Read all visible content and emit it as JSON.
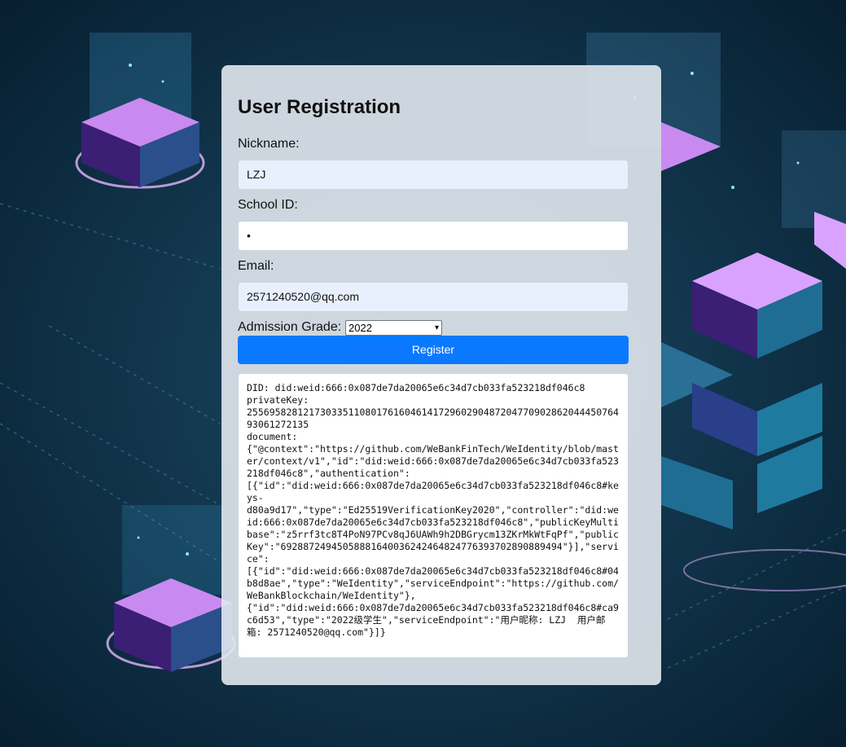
{
  "form": {
    "title": "User Registration",
    "nickname_label": "Nickname:",
    "nickname_value": "LZJ",
    "school_id_label": "School ID:",
    "school_id_value": "•",
    "email_label": "Email:",
    "email_value": "2571240520@qq.com",
    "grade_label": "Admission Grade:",
    "grade_value": "2022",
    "register_label": "Register",
    "output": "DID: did:weid:666:0x087de7da20065e6c34d7cb033fa523218df046c8\nprivateKey:\n25569582812173033511080176160461417296029048720477090286204445076493061272135\ndocument:\n{\"@context\":\"https://github.com/WeBankFinTech/WeIdentity/blob/master/context/v1\",\"id\":\"did:weid:666:0x087de7da20065e6c34d7cb033fa523218df046c8\",\"authentication\":\n[{\"id\":\"did:weid:666:0x087de7da20065e6c34d7cb033fa523218df046c8#keys-\nd80a9d17\",\"type\":\"Ed25519VerificationKey2020\",\"controller\":\"did:weid:666:0x087de7da20065e6c34d7cb033fa523218df046c8\",\"publicKeyMultibase\":\"z5rrf3tc8T4PoN97PCv8qJ6UAWh9h2DBGrycm13ZKrMkWtFqPf\",\"publicKey\":\"69288724945058881640036242464824776393702890889494\"}],\"service\":\n[{\"id\":\"did:weid:666:0x087de7da20065e6c34d7cb033fa523218df046c8#04b8d8ae\",\"type\":\"WeIdentity\",\"serviceEndpoint\":\"https://github.com/WeBankBlockchain/WeIdentity\"},\n{\"id\":\"did:weid:666:0x087de7da20065e6c34d7cb033fa523218df046c8#ca9c6d53\",\"type\":\"2022级学生\",\"serviceEndpoint\":\"用户昵称: LZJ  用户邮箱: 2571240520@qq.com\"}]}"
  }
}
